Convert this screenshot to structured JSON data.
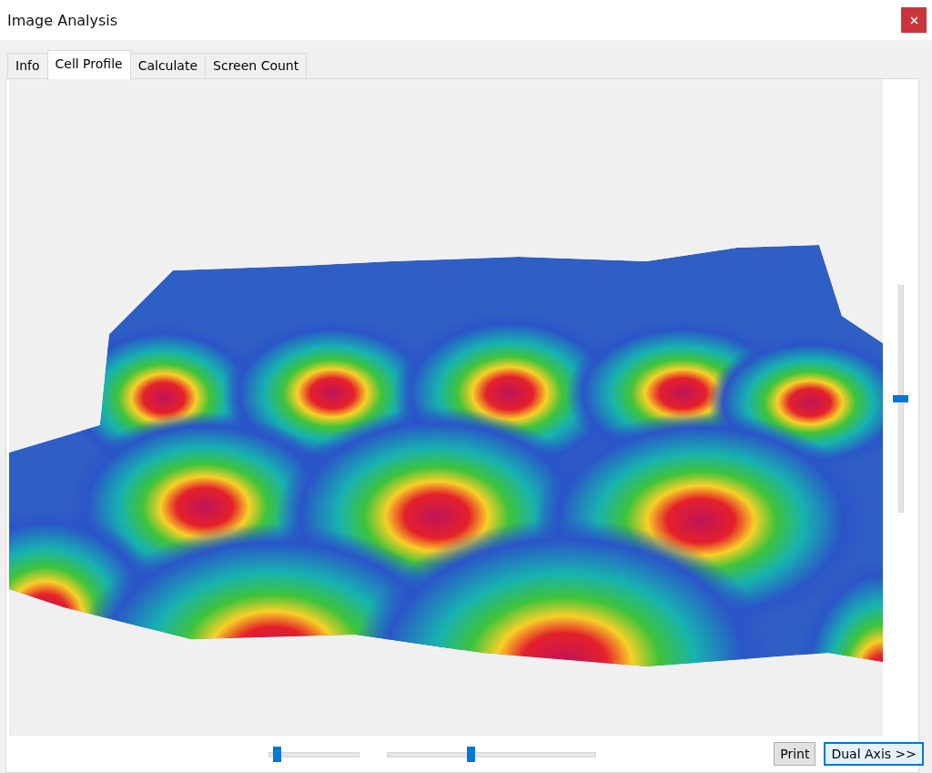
{
  "window": {
    "title": "Image Analysis"
  },
  "tabs": [
    {
      "label": "Info",
      "selected": false
    },
    {
      "label": "Cell Profile",
      "selected": true
    },
    {
      "label": "Calculate",
      "selected": false
    },
    {
      "label": "Screen Count",
      "selected": false
    }
  ],
  "sliders": [
    {
      "kind": "vertical",
      "level": 0.5
    },
    {
      "kind": "horizontal",
      "level": 0.05
    },
    {
      "kind": "horizontal",
      "level": 0.4
    }
  ],
  "buttons": [
    {
      "label": "Print",
      "selected": false
    },
    {
      "label": "Dual Axis >>",
      "selected": true
    }
  ]
}
